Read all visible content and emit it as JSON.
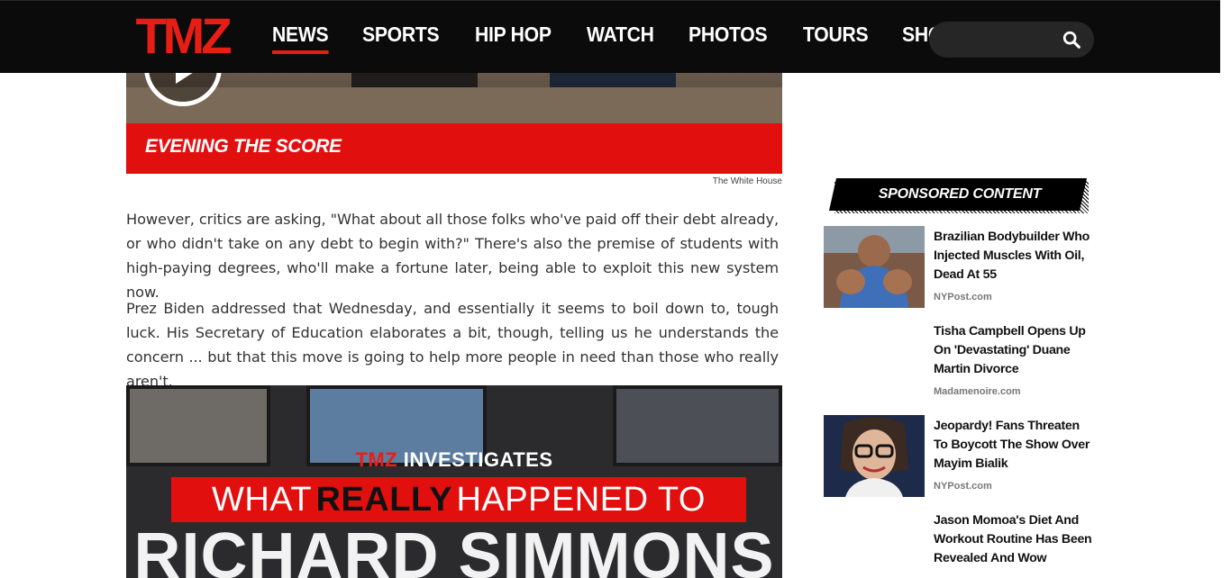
{
  "header": {
    "logo_text": "TMZ",
    "nav": [
      "NEWS",
      "SPORTS",
      "HIP HOP",
      "WATCH",
      "PHOTOS",
      "TOURS",
      "SHOP"
    ],
    "active_nav": "NEWS",
    "search_placeholder": "",
    "brand_color": "#e81e16"
  },
  "hero": {
    "banner_label": "EVENING THE SCORE",
    "credit": "The White House"
  },
  "article": {
    "paragraphs": [
      "However, critics are asking, \"What about all those folks who've paid off their debt already, or who didn't take on any debt to begin with?\" There's also the premise of students with high-paying degrees, who'll make a fortune later, being able to exploit this new system now.",
      "Prez Biden addressed that Wednesday, and essentially it seems to boil down to, tough luck. His Secretary of Education elaborates a bit, though, telling us he understands the concern ... but that this move is going to help more people in need than those who really aren't."
    ]
  },
  "video2": {
    "kicker_brand": "TMZ",
    "kicker_rest": "INVESTIGATES",
    "line1_pre": "WHAT",
    "line1_bold": "REALLY",
    "line1_post": "HAPPENED TO",
    "line2": "RICHARD SIMMONS"
  },
  "sidebar": {
    "sponsored_label": "SPONSORED CONTENT",
    "ads": [
      {
        "headline": "Brazilian Bodybuilder Who Injected Muscles With Oil, Dead At 55",
        "source": "NYPost.com",
        "has_image": true
      },
      {
        "headline": "Tisha Campbell Opens Up On 'Devastating' Duane Martin Divorce",
        "source": "Madamenoire.com",
        "has_image": false
      },
      {
        "headline": "Jeopardy! Fans Threaten To Boycott The Show Over Mayim Bialik",
        "source": "NYPost.com",
        "has_image": true
      },
      {
        "headline": "Jason Momoa's Diet And Workout Routine Has Been Revealed And Wow",
        "source": "",
        "has_image": false
      }
    ]
  }
}
